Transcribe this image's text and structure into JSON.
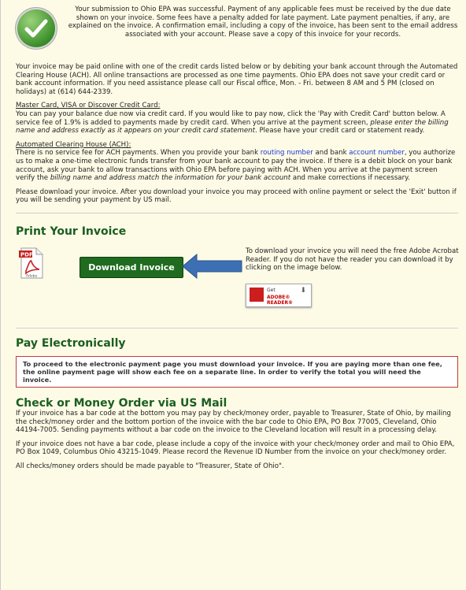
{
  "success_message": "Your submission to Ohio EPA was successful. Payment of any applicable fees must be received by the due date shown on your invoice. Some fees have a penalty added for late payment. Late payment penalties, if any, are explained on the invoice. A confirmation email, including a copy of the invoice, has been sent to the email address associated with your account. Please save a copy of this invoice for your records.",
  "intro": "Your invoice may be paid online with one of the credit cards listed below or by debiting your bank account through the Automated Clearing House (ACH). All online transactions are processed as one time payments. Ohio EPA does not save your credit card or bank account information. If you need assistance please call our Fiscal office, Mon. - Fri. between 8 AM and 5 PM (closed on holidays) at (614) 644-2339.",
  "credit_card": {
    "heading": "Master Card, VISA or Discover Credit Card:",
    "text_1": "You can pay your balance due now via credit card. If you would like to pay now, click the 'Pay with Credit Card' button below. A service fee of 1.9% is added to payments made by credit card. When you arrive at the payment screen, ",
    "text_em": "please enter the billing name and address exactly as it appears on your credit card statement",
    "text_2": ". Please have your credit card or statement ready."
  },
  "ach": {
    "heading": "Automated Clearing House (ACH):",
    "text_1": "There is no service fee for ACH payments. When you provide your bank ",
    "routing_link": "routing number",
    "text_2": " and bank ",
    "account_link": "account number",
    "text_3": ", you authorize us to make a one-time electronic funds transfer from your bank account to pay the invoice. If there is a debit block on your bank account, ask your bank to allow transactions with Ohio EPA before paying with ACH. When you arrive at the payment screen verify the ",
    "text_em": "billing name and address match the information for your bank account",
    "text_4": " and make corrections if necessary."
  },
  "download_note": "Please download your invoice. After you download your invoice you may proceed with online payment or select the 'Exit' button if you will be sending your payment by US mail.",
  "print_section": {
    "title": "Print Your Invoice",
    "pdf_label": "PDF",
    "adobe_label": "Adobe",
    "download_button": "Download Invoice",
    "reader_text": "To download your invoice you will need the free Adobe Acrobat Reader. If you do not have the reader you can download it by clicking on the image below.",
    "badge_get": "Get",
    "badge_reader": "ADOBE® READER®"
  },
  "pay_section": {
    "title": "Pay Electronically",
    "notice": "To proceed to the electronic payment page you must download your invoice. If you are paying more than one fee, the online payment page will show each fee on a separate line. In order to verify the total you will need the invoice."
  },
  "mail_section": {
    "title": "Check or Money Order via US Mail",
    "para_1": "If your invoice has a bar code at the bottom you may pay by check/money order, payable to Treasurer, State of Ohio, by mailing the check/money order and the bottom portion of the invoice with the bar code to Ohio EPA, PO Box 77005, Cleveland, Ohio  44194-7005.  Sending payments without a bar code on the invoice to the Cleveland location will result in a processing delay.",
    "para_2": "If your invoice does not have a bar code, please include a copy of the invoice with your check/money order and mail to Ohio EPA, PO Box 1049, Columbus Ohio 43215-1049.  Please record the Revenue ID Number from the invoice on your check/money order.",
    "para_3": "All checks/money orders should be made payable to \"Treasurer, State of Ohio\"."
  },
  "colors": {
    "background": "#fdfbe6",
    "heading_green": "#1a5e20",
    "button_green": "#1f6b1f",
    "link_blue": "#1a38d6",
    "notice_border": "#c23a3a",
    "arrow_blue": "#3d6fb5"
  }
}
